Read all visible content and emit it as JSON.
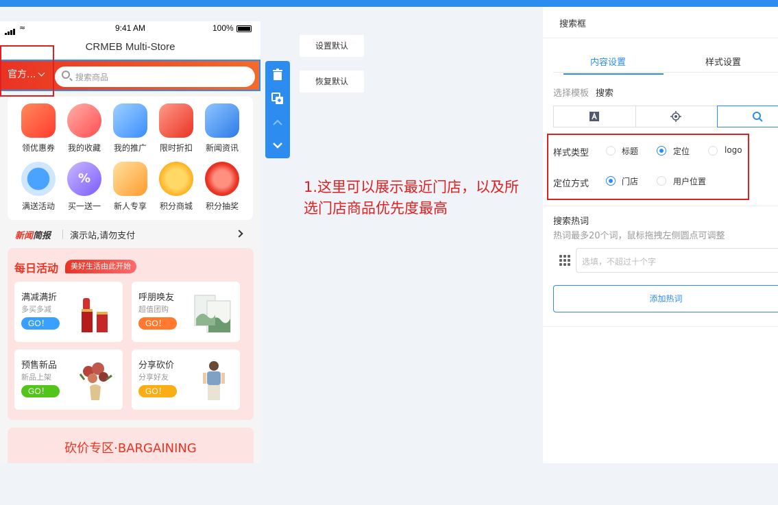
{
  "phone": {
    "status": {
      "time": "9:41 AM",
      "battery": "100%"
    },
    "title": "CRMEB Multi-Store",
    "store_label": "官方...",
    "search_placeholder": "搜索商品",
    "menu": [
      {
        "label": "领优惠券",
        "icon": "coupon-icon",
        "color": "#ff5a3c"
      },
      {
        "label": "我的收藏",
        "icon": "favorite-icon",
        "color": "#ff6b6b"
      },
      {
        "label": "我的推广",
        "icon": "promotion-icon",
        "color": "#4f9cf7"
      },
      {
        "label": "限时折扣",
        "icon": "discount-icon",
        "color": "#ff4d4f"
      },
      {
        "label": "新闻资讯",
        "icon": "news-icon",
        "color": "#3a8dff"
      },
      {
        "label": "满送活动",
        "icon": "alarm-icon",
        "color": "#4aa3ff"
      },
      {
        "label": "买一送一",
        "icon": "percent-icon",
        "color": "#9b7bff"
      },
      {
        "label": "新人专享",
        "icon": "gift-icon",
        "color": "#ffb84d"
      },
      {
        "label": "积分商城",
        "icon": "coins-icon",
        "color": "#ffc233"
      },
      {
        "label": "积分抽奖",
        "icon": "lottery-icon",
        "color": "#ff4d4f"
      }
    ],
    "news": {
      "tag_a": "新闻",
      "tag_b": "简报",
      "text": "演示站,请勿支付"
    },
    "activity": {
      "title": "每日活动",
      "badge": "美好生活由此开始",
      "cards": [
        {
          "title": "满减满折",
          "sub": "多买多减",
          "go": "GO！",
          "color": "#3aa0ff",
          "pic": "lipstick-image"
        },
        {
          "title": "呼朋唤友",
          "sub": "超值团购",
          "go": "GO！",
          "color": "#ff7a2e",
          "pic": "painting-image"
        },
        {
          "title": "预售新品",
          "sub": "新品上架",
          "go": "GO！",
          "color": "#52c41a",
          "pic": "flower-vase-image"
        },
        {
          "title": "分享砍价",
          "sub": "分享好友",
          "go": "GO！",
          "color": "#faad14",
          "pic": "model-image"
        }
      ]
    },
    "bargain_title": "砍价专区·BARGAINING"
  },
  "buttons": {
    "set_default": "设置默认",
    "restore_default": "恢复默认"
  },
  "note": "1.这里可以展示最近门店，以及所选门店商品优先度最高",
  "panel": {
    "header": "搜索框",
    "tabs": [
      "内容设置",
      "样式设置"
    ],
    "template": {
      "label": "选择模板",
      "value": "搜索"
    },
    "style_type": {
      "label": "样式类型",
      "options": [
        "标题",
        "定位",
        "logo"
      ],
      "selected": "定位"
    },
    "location_mode": {
      "label": "定位方式",
      "options": [
        "门店",
        "用户位置"
      ],
      "selected": "门店"
    },
    "hot_words": {
      "title": "搜索热词",
      "tip": "热词最多20个词，鼠标拖拽左侧圆点可调整",
      "placeholder": "选填，不超过十个字",
      "add_label": "添加热词"
    },
    "accent": "#2d8cf0"
  }
}
